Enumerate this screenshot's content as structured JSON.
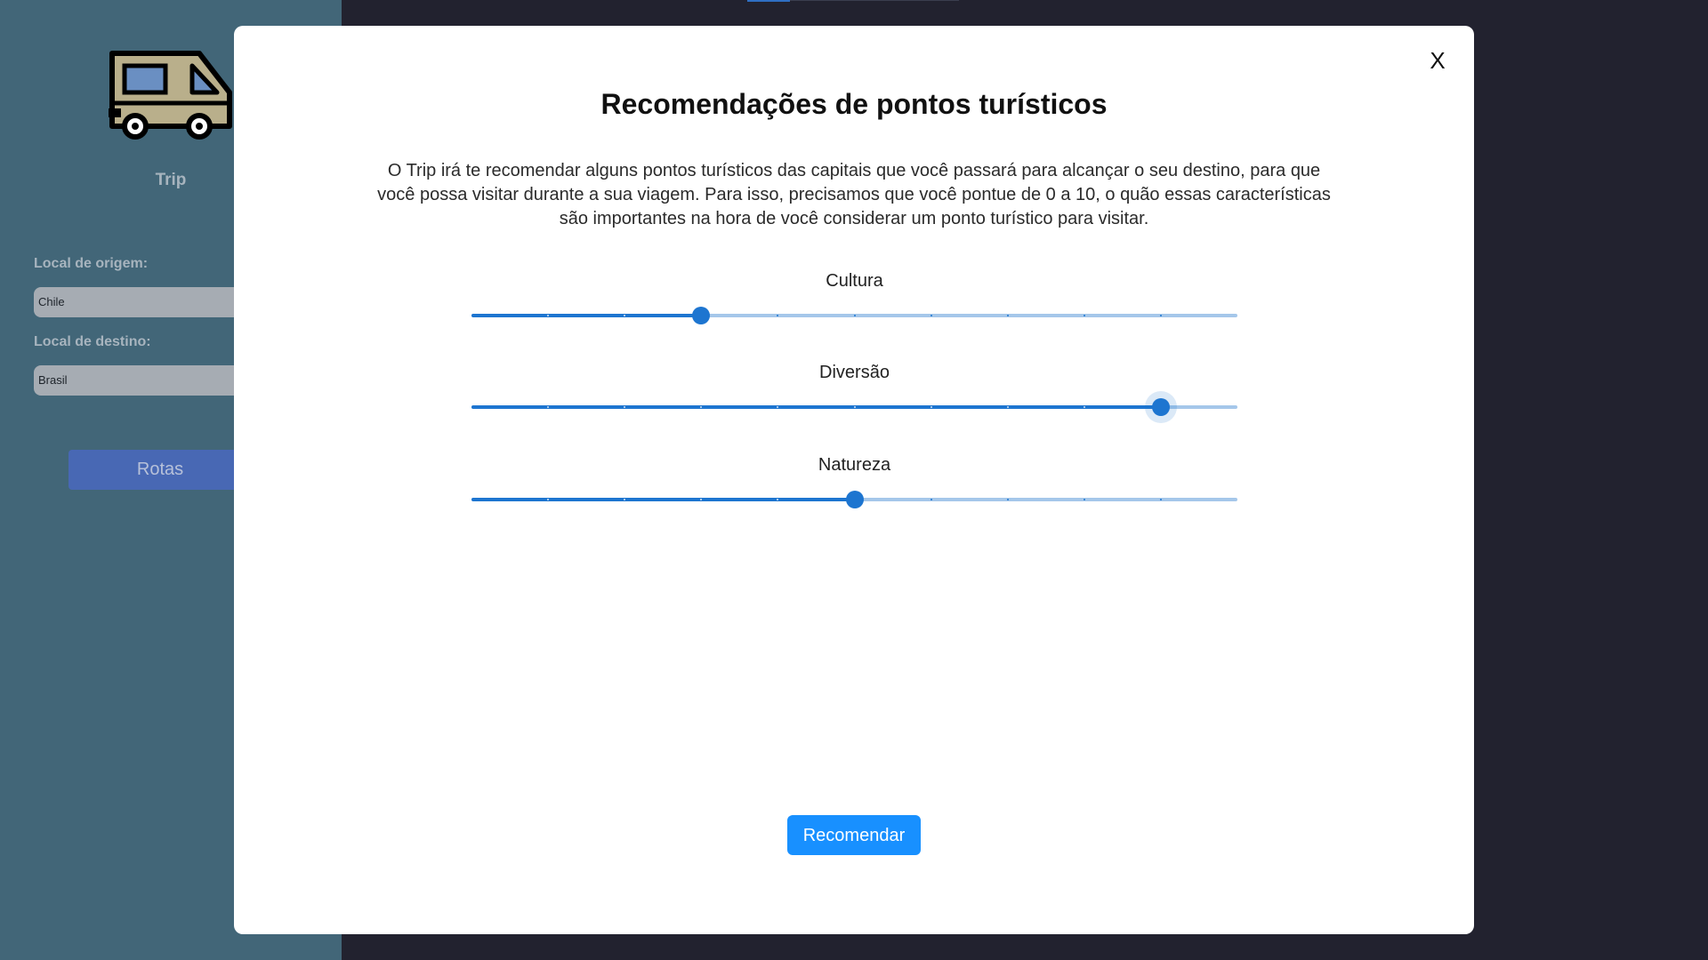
{
  "sidebar": {
    "app_name": "Trip",
    "origin": {
      "label": "Local de origem:",
      "value": "Chile"
    },
    "destination": {
      "label": "Local de destino:",
      "value": "Brasil"
    },
    "routes_button": "Rotas",
    "logo_icon": "camper-van-icon"
  },
  "modal": {
    "close_label": "X",
    "title": "Recomendações de pontos turísticos",
    "description": "O Trip irá te recomendar alguns pontos turísticos das capitais que você passará para alcançar o seu destino, para que você possa visitar durante a sua viagem. Para isso, precisamos que você pontue de 0 a 10, o quão essas características são importantes na hora de você considerar um ponto turístico para visitar.",
    "scale": {
      "min": 0,
      "max": 10,
      "step": 1
    },
    "sliders": [
      {
        "label": "Cultura",
        "value": 3
      },
      {
        "label": "Diversão",
        "value": 9
      },
      {
        "label": "Natureza",
        "value": 5
      }
    ],
    "submit_label": "Recomendar"
  },
  "colors": {
    "sidebar_bg": "#426678",
    "page_bg": "#22222f",
    "slider_accent": "#1d75d0",
    "slider_rail": "#a5c7ea",
    "primary_button": "#1890ff",
    "routes_button": "#4868b4"
  }
}
